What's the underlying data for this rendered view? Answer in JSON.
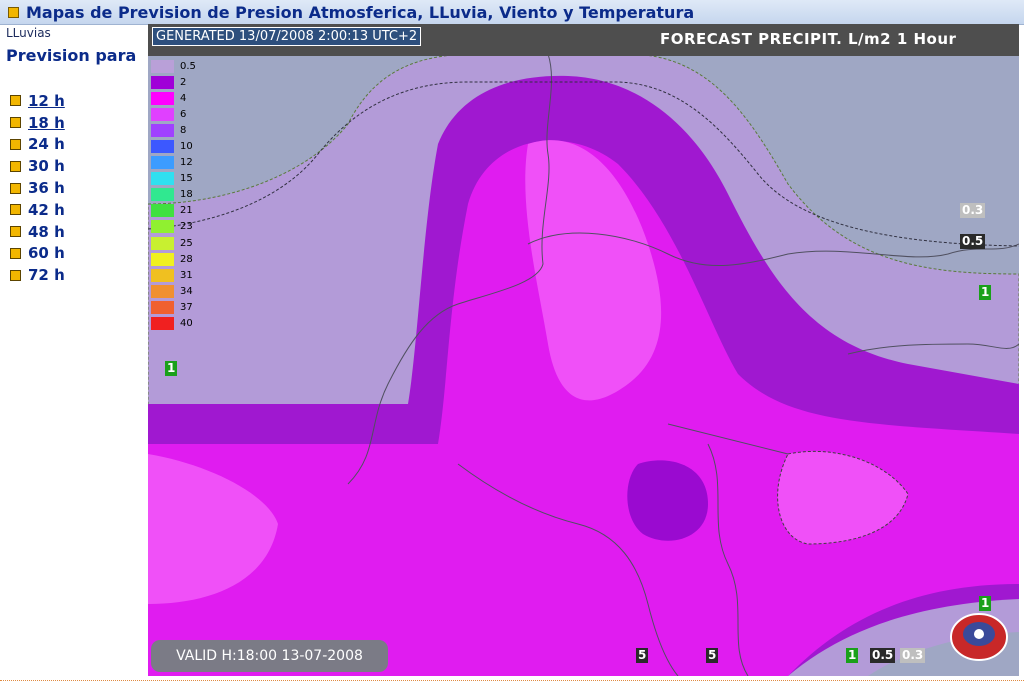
{
  "header": {
    "title": "Mapas de Prevision de Presion Atmosferica, LLuvia, Viento y Temperatura"
  },
  "sidebar": {
    "breadcrumb": "LLuvias",
    "title": "Prevision para",
    "hours": [
      {
        "label": "12 h"
      },
      {
        "label": "18 h"
      },
      {
        "label": "24 h"
      },
      {
        "label": "30 h"
      },
      {
        "label": "36 h"
      },
      {
        "label": "42 h"
      },
      {
        "label": "48 h"
      },
      {
        "label": "60 h"
      },
      {
        "label": "72 h"
      }
    ]
  },
  "map": {
    "generated": "GENERATED 13/07/2008 2:00:13 UTC+2",
    "forecast_title": "FORECAST  PRECIPIT. L/m2  1 Hour",
    "valid": "VALID H:18:00  13-07-2008",
    "legend": [
      {
        "label": "0.5",
        "color": "#b9a0d8"
      },
      {
        "label": "2",
        "color": "#a000d8"
      },
      {
        "label": "4",
        "color": "#ff00ff"
      },
      {
        "label": "6",
        "color": "#e040ff"
      },
      {
        "label": "8",
        "color": "#a040ff"
      },
      {
        "label": "10",
        "color": "#3c58ff"
      },
      {
        "label": "12",
        "color": "#3c9cff"
      },
      {
        "label": "15",
        "color": "#30e0f0"
      },
      {
        "label": "18",
        "color": "#30e890"
      },
      {
        "label": "21",
        "color": "#40e040"
      },
      {
        "label": "23",
        "color": "#90f030"
      },
      {
        "label": "25",
        "color": "#c8f030"
      },
      {
        "label": "28",
        "color": "#f0f020"
      },
      {
        "label": "31",
        "color": "#f0c020"
      },
      {
        "label": "34",
        "color": "#f09030"
      },
      {
        "label": "37",
        "color": "#f06030"
      },
      {
        "label": "40",
        "color": "#f02020"
      }
    ],
    "contour_labels": {
      "c1": "0.3",
      "c2": "0.5",
      "c3": "1",
      "c4": "1",
      "c5": "1",
      "c6": "1",
      "c7": "0.5",
      "c8": "0.3",
      "c9": "5",
      "c10": "5"
    }
  }
}
